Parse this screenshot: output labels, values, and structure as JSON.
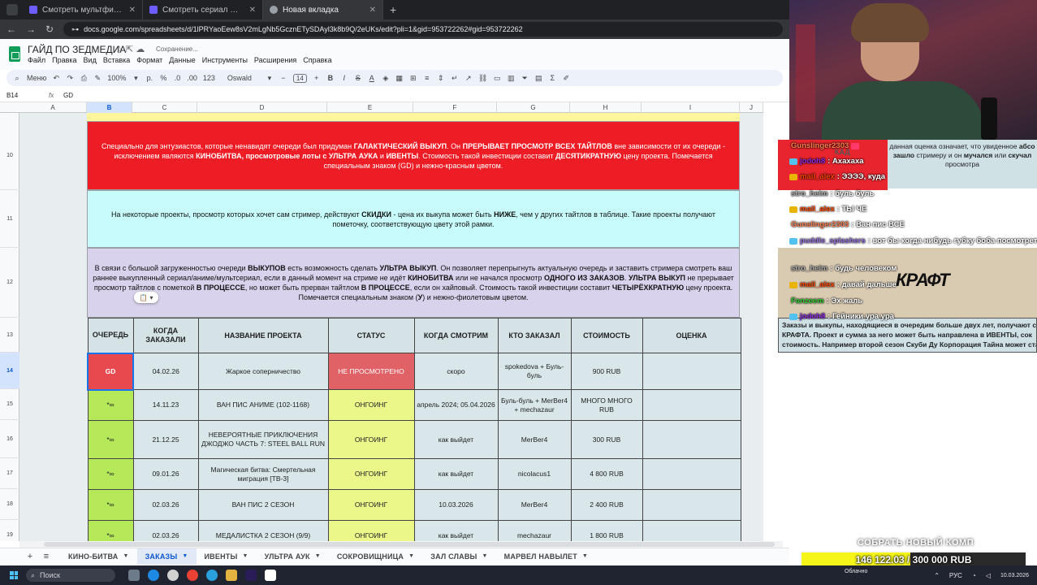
{
  "browser": {
    "tabs": [
      {
        "title": "Смотреть мультфильм Губка",
        "active": false
      },
      {
        "title": "Смотреть сериал One Piece. Б",
        "active": false
      },
      {
        "title": "Новая вкладка",
        "active": true
      }
    ],
    "url": "docs.google.com/spreadsheets/d/1lPRYaoEew8sV2mLgNb5GcznETySDAyl3k8b9Q/2eUKs/edit?pli=1&gid=953722262#gid=953722262"
  },
  "sheets": {
    "title": "ГАЙД ПО ЗЕДМЕДИА",
    "saving": "Сохранение...",
    "menu": [
      "Файл",
      "Правка",
      "Вид",
      "Вставка",
      "Формат",
      "Данные",
      "Инструменты",
      "Расширения",
      "Справка"
    ],
    "toolbar": {
      "menu_label": "Меню",
      "zoom": "100%",
      "font": "Oswald",
      "font_size": "14",
      "currency": "р.",
      "percent": "%",
      "fmt123": "123"
    },
    "namebox": "B14",
    "formula_value": "GD",
    "columns": [
      "A",
      "B",
      "C",
      "D",
      "E",
      "F",
      "G",
      "H",
      "I",
      "J"
    ],
    "rows": [
      "10",
      "11",
      "12",
      "13",
      "14",
      "15",
      "16",
      "17",
      "18",
      "19"
    ],
    "info_red": {
      "p1": "Специально для энтузиастов, которые ненавидят очереди был придуман ",
      "b1": "ГАЛАКТИЧЕСКИЙ ВЫКУП",
      "p2": ". Он ",
      "b2": "ПРЕРЫВАЕТ ПРОСМОТР ВСЕХ ТАЙТЛОВ",
      "p3": " вне зависимости от их очереди - исключением являются ",
      "b3": "КИНОБИТВА, просмотровые лоты с УЛЬТРА АУКА",
      "p4": " и ",
      "b4": "ИВЕНТЫ",
      "p5": ". Стоимость такой инвестиции составит ",
      "b5": "ДЕСЯТИКРАТНУЮ",
      "p6": " цену проекта. Помечается специальным знаком (GD) и нежно-красным цветом."
    },
    "info_cyan": {
      "p1": "На некоторые проекты, просмотр которых хочет сам стример, действуют ",
      "b1": "СКИДКИ",
      "p2": " - цена их выкупа может быть ",
      "b2": "НИЖЕ",
      "p3": ", чем у других тайтлов в таблице. Такие проекты получают пометочку, соответствующую цвету этой рамки."
    },
    "info_purple": {
      "p1": "В связи с большой загруженностью очереди ",
      "b1": "ВЫКУПОВ",
      "p2": " есть возможность сделать ",
      "b2": "УЛЬТРА ВЫКУП",
      "p3": ". Он позволяет перепрыгнуть актуальную очередь и заставить стримера смотреть ваш раннее выкупленный сериал/аниме/мультсериал, если в данный момент на стриме не идёт ",
      "b3": "КИНОБИТВА",
      "p4": " или не начался просмотр ",
      "b4": "ОДНОГО ИЗ ЗАКАЗОВ",
      "p5": ". ",
      "b5": "УЛЬТРА ВЫКУП",
      "p6": " не прерывает просмотр тайтлов с пометкой ",
      "b6": "В ПРОЦЕССЕ",
      "p7": ", но может быть прерван тайтлом ",
      "b7": "В ПРОЦЕССЕ",
      "p8": ", если он хайповый. Стоимость такой инвестиции составит ",
      "b8": "ЧЕТЫРЁХКРАТНУЮ",
      "p9": " цену проекта. Помечается специальным знаком (",
      "b9": "У",
      "p10": ") и нежно-фиолетовым цветом."
    },
    "table": {
      "headers": [
        "ОЧЕРЕДЬ",
        "КОГДА ЗАКАЗАЛИ",
        "НАЗВАНИЕ ПРОЕКТА",
        "СТАТУС",
        "КОГДА СМОТРИМ",
        "КТО ЗАКАЗАЛ",
        "СТОИМОСТЬ",
        "ОЦЕНКА"
      ],
      "rows": [
        {
          "queue": "GD",
          "date": "04.02.26",
          "title": "Жаркое соперничество",
          "status": "НЕ ПРОСМОТРЕНО",
          "when": "скоро",
          "who": "spokedova + Буль-буль",
          "cost": "900 RUB",
          "rating": ""
        },
        {
          "queue": "*∞",
          "date": "14.11.23",
          "title": "ВАН ПИС АНИМЕ (102-1168)",
          "status": "ОНГОИНГ",
          "when": "апрель 2024; 05.04.2026",
          "who": "Буль-буль + MerBer4 + mechazaur",
          "cost": "МНОГО МНОГО RUB",
          "rating": ""
        },
        {
          "queue": "*∞",
          "date": "21.12.25",
          "title": "НЕВЕРОЯТНЫЕ ПРИКЛЮЧЕНИЯ ДЖОДЖО ЧАСТЬ 7: STEEL BALL RUN",
          "status": "ОНГОИНГ",
          "when": "как выйдет",
          "who": "MerBer4",
          "cost": "300 RUB",
          "rating": ""
        },
        {
          "queue": "*∞",
          "date": "09.01.26",
          "title": "Магическая битва: Смертельная миграция [ТВ-3]",
          "status": "ОНГОИНГ",
          "when": "как выйдет",
          "who": "nicolacus1",
          "cost": "4 800 RUB",
          "rating": ""
        },
        {
          "queue": "*∞",
          "date": "02.03.26",
          "title": "ВАН ПИС 2 СЕЗОН",
          "status": "ОНГОИНГ",
          "when": "10.03.2026",
          "who": "MerBer4",
          "cost": "2 400 RUB",
          "rating": ""
        },
        {
          "queue": "*∞",
          "date": "02.03.26",
          "title": "МЕДАЛИСТКА 2 СЕЗОН (9/9)",
          "status": "ОНГОИНГ",
          "when": "как выйдет",
          "who": "mechazaur",
          "cost": "1 800 RUB",
          "rating": ""
        }
      ]
    },
    "sheet_tabs": [
      "КИНО-БИТВА",
      "ЗАКАЗЫ",
      "ИВЕНТЫ",
      "УЛЬТРА АУК",
      "СОКРОВИЩНИЦА",
      "ЗАЛ СЛАВЫ",
      "МАРВЕЛ НАВЫЛЕТ"
    ],
    "active_sheet": "ЗАКАЗЫ"
  },
  "overlay": {
    "note": {
      "p1": "данная оценка означает, что увиденное ",
      "b1": "абсо",
      "p2": " ",
      "b2": "зашло",
      "p3": " стримеру и он ",
      "b3": "мучался",
      "p4": " или ",
      "b4": "скучал",
      "p5": " просмотра"
    },
    "kad": "КАД",
    "chat": [
      {
        "user": "Gunslinger2303",
        "text": "",
        "color": "#ff7f50"
      },
      {
        "user": "jodoh8",
        "text": ": Ахахаха",
        "color": "#8a2be2"
      },
      {
        "user": "mail_alex",
        "text": ": ЭЭЭЭ, куда",
        "color": "#ff4500"
      },
      {
        "user": "stro_heim",
        "text": ": буль буль",
        "color": "#a9a9a9"
      },
      {
        "user": "mail_alex",
        "text": ": ТЫ ЧЕ",
        "color": "#ff4500"
      },
      {
        "user": "Gunslinger2303",
        "text": ": Ван пис ВСЕ",
        "color": "#ff7f50"
      },
      {
        "user": "puddle_splashers",
        "text": ": вот бы когда нибудь губку боба посмотреть...",
        "color": "#9370db"
      },
      {
        "user": "stro_heim",
        "text": ": будь человеком",
        "color": "#a9a9a9"
      },
      {
        "user": "mail_alex",
        "text": ": давай дальше",
        "color": "#ff4500"
      },
      {
        "user": "Fanzeem",
        "text": ": Эх жаль",
        "color": "#32cd32"
      },
      {
        "user": "jodoh8",
        "text": ": Гейники ура ура",
        "color": "#8a2be2"
      }
    ],
    "kraft": "КРАФТ",
    "bottom_note": {
      "p1": "Заказы и выкупы, находящиеся в очередим больше двух лет, получают сп",
      "b1": "КРАФТА",
      "p2": ". Проект и сумма за него может  быть направлена в ",
      "b2": "ИВЕНТЫ",
      "p3": ", сок",
      "p4": "стоимость. Например второй сезон Скуби Ду Корпорация Тайна может ста"
    },
    "goal_title": "СОБРАТЬ НОВЫЙ КОМП",
    "goal_text": "146 122.03 / 300 000 RUB",
    "goal_progress": 0.487
  },
  "taskbar": {
    "search": "Поиск",
    "weather_temp": "",
    "weather_text": "Облачно",
    "lang": "РУС",
    "time": "",
    "date": "10.03.2026"
  }
}
